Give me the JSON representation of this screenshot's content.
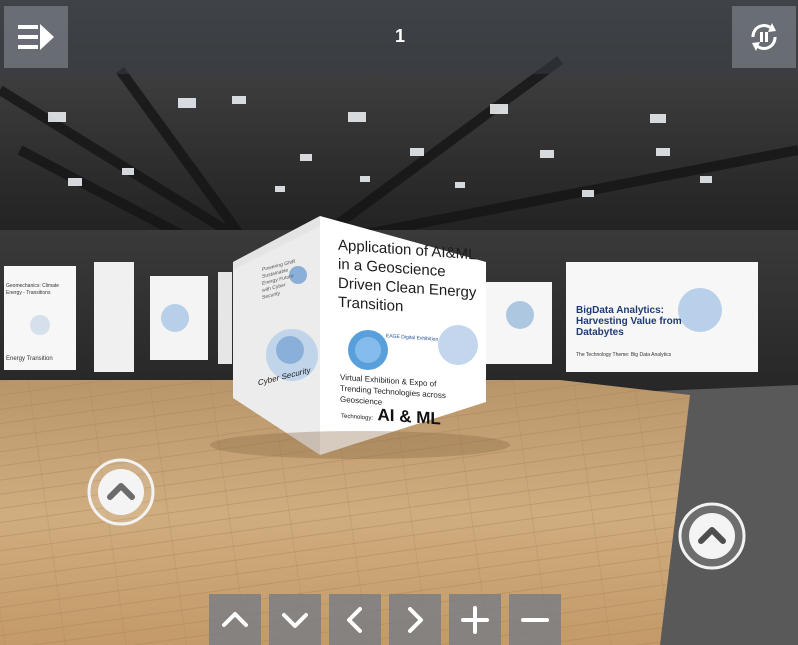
{
  "topbar": {
    "scene_number": "1",
    "menu_icon": "menu-arrow-icon",
    "autorotate_icon": "autorotate-pause-icon"
  },
  "cube": {
    "title": "Application of AI&ML in a Geoscience Driven Clean Energy Transition",
    "subtitle": "Virtual Exhibition & Expo of Trending Technologies across Geoscience",
    "technology_prefix": "Technology:",
    "technology": "AI & ML",
    "brand": "EAGE Digital Exhibition",
    "left_face_title": "Powering GNR Sustainable Energy Future with Cyber Security",
    "left_face_tech": "Cyber Security"
  },
  "panels": {
    "right": {
      "title": "BigData Analytics: Harvesting Value from Databytes",
      "footer": "The Technology Theme: Big Data Analytics"
    },
    "left": {
      "title": "Geomechanics: Climate Energy - Transitions",
      "footer": "Energy Transition"
    }
  },
  "hotspots": {
    "left_icon": "chevron-up-circle-icon",
    "right_icon": "chevron-up-circle-icon"
  },
  "nav": [
    {
      "name": "up",
      "icon": "chevron-up-icon"
    },
    {
      "name": "down",
      "icon": "chevron-down-icon"
    },
    {
      "name": "left",
      "icon": "chevron-left-icon"
    },
    {
      "name": "right",
      "icon": "chevron-right-icon"
    },
    {
      "name": "zoom-in",
      "icon": "plus-icon"
    },
    {
      "name": "zoom-out",
      "icon": "minus-icon"
    }
  ],
  "colors": {
    "floor": "#c9a676",
    "carpet": "#5a5a5a",
    "ceiling": "#2e2e2e",
    "ui_button": "#787c84",
    "panel_white": "#f7f7f7"
  }
}
